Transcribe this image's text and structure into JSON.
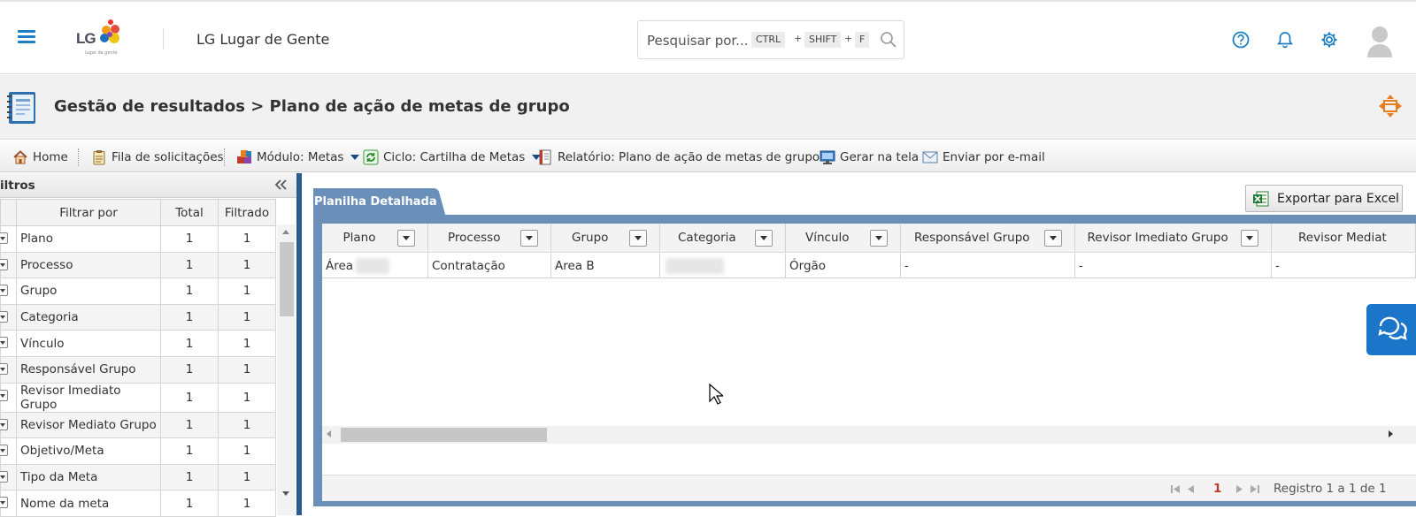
{
  "header": {
    "logo_text": "LG",
    "logo_tagline": "lugar de gente",
    "app_title": "LG Lugar de Gente",
    "search": {
      "placeholder": "Pesquisar por...",
      "keys": [
        "CTRL",
        "SHIFT",
        "F"
      ],
      "plus": "+"
    },
    "icons": [
      "menu-icon",
      "help-icon",
      "bell-icon",
      "gear-icon",
      "avatar"
    ],
    "accent_color": "#1d7fc4"
  },
  "page": {
    "title": "Gestão de resultados > Plano de ação de metas de grupo"
  },
  "toolbar": {
    "home": "Home",
    "queue": "Fila de solicitações",
    "module": "Módulo: Metas",
    "cycle": "Ciclo: Cartilha de Metas",
    "report": "Relatório: Plano de ação de metas de grupo",
    "generate": "Gerar na tela",
    "email": "Enviar por e-mail"
  },
  "filters": {
    "title": "iltros",
    "columns": {
      "filter_by": "Filtrar por",
      "total": "Total",
      "filtered": "Filtrado"
    },
    "rows": [
      {
        "name": "Plano",
        "total": "1",
        "filtered": "1"
      },
      {
        "name": "Processo",
        "total": "1",
        "filtered": "1"
      },
      {
        "name": "Grupo",
        "total": "1",
        "filtered": "1"
      },
      {
        "name": "Categoria",
        "total": "1",
        "filtered": "1"
      },
      {
        "name": "Vínculo",
        "total": "1",
        "filtered": "1"
      },
      {
        "name": "Responsável Grupo",
        "total": "1",
        "filtered": "1"
      },
      {
        "name": "Revisor Imediato Grupo",
        "total": "1",
        "filtered": "1"
      },
      {
        "name": "Revisor Mediato Grupo",
        "total": "1",
        "filtered": "1"
      },
      {
        "name": "Objetivo/Meta",
        "total": "1",
        "filtered": "1"
      },
      {
        "name": "Tipo da Meta",
        "total": "1",
        "filtered": "1"
      },
      {
        "name": "Nome da meta",
        "total": "1",
        "filtered": "1"
      }
    ]
  },
  "main": {
    "tab": "Planilha Detalhada",
    "export_button": "Exportar para Excel",
    "grid": {
      "columns": [
        "Plano",
        "Processo",
        "Grupo",
        "Categoria",
        "Vínculo",
        "Responsável Grupo",
        "Revisor Imediato Grupo",
        "Revisor Mediat"
      ],
      "rows": [
        [
          "Área",
          "Contratação",
          "Area B",
          "",
          "Órgão",
          "-",
          "-",
          "-"
        ]
      ]
    },
    "pager": {
      "current_page": "1",
      "info": "Registro 1 a 1 de 1"
    }
  }
}
